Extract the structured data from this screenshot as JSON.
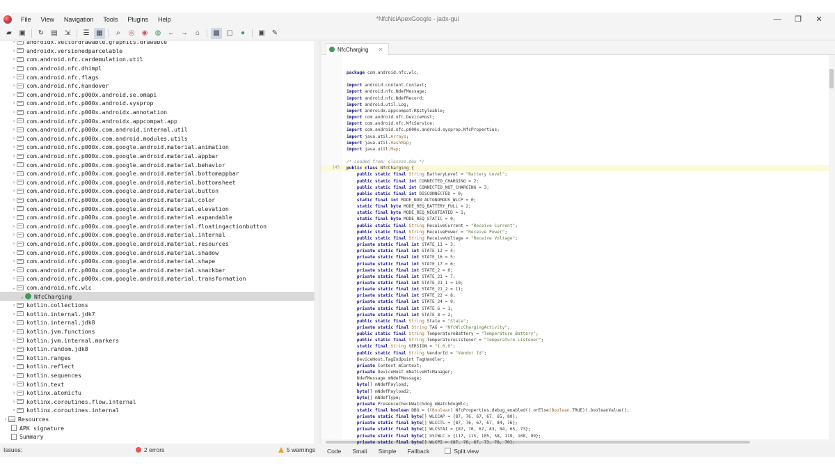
{
  "window": {
    "title": "*NfcNciApexGoogle - jadx-gui"
  },
  "menu": [
    "File",
    "View",
    "Navigation",
    "Tools",
    "Plugins",
    "Help"
  ],
  "window_controls": [
    "—",
    "❐",
    "✕"
  ],
  "toolbar_icons": [
    "open-file-icon",
    "add-file-icon",
    "reload-icon",
    "save-icon",
    "export-icon",
    "flatten-icon",
    "sync-tree-icon",
    "search-icon",
    "find-class-icon",
    "find-usage-icon",
    "find-text-icon",
    "back-icon",
    "forward-icon",
    "home-icon",
    "quark-icon",
    "log-icon",
    "decompile-icon",
    "preferences-icon",
    "settings-icon"
  ],
  "tree": {
    "truncated_top": "androidx.vectordrawable.graphics.drawable",
    "items": [
      "androidx.versionedparcelable",
      "com.android.nfc.cardemulation.util",
      "com.android.nfc.dhimpl",
      "com.android.nfc.flags",
      "com.android.nfc.handover",
      "com.android.nfc.p000x.android.se.omapi",
      "com.android.nfc.p000x.android.sysprop",
      "com.android.nfc.p000x.androidx.annotation",
      "com.android.nfc.p000x.androidx.appcompat.app",
      "com.android.nfc.p000x.com.android.internal.util",
      "com.android.nfc.p000x.com.android.modules.utils",
      "com.android.nfc.p000x.com.google.android.material.animation",
      "com.android.nfc.p000x.com.google.android.material.appbar",
      "com.android.nfc.p000x.com.google.android.material.behavior",
      "com.android.nfc.p000x.com.google.android.material.bottomappbar",
      "com.android.nfc.p000x.com.google.android.material.bottomsheet",
      "com.android.nfc.p000x.com.google.android.material.button",
      "com.android.nfc.p000x.com.google.android.material.color",
      "com.android.nfc.p000x.com.google.android.material.elevation",
      "com.android.nfc.p000x.com.google.android.material.expandable",
      "com.android.nfc.p000x.com.google.android.material.floatingactionbutton",
      "com.android.nfc.p000x.com.google.android.material.internal",
      "com.android.nfc.p000x.com.google.android.material.resources",
      "com.android.nfc.p000x.com.google.android.material.shadow",
      "com.android.nfc.p000x.com.google.android.material.shape",
      "com.android.nfc.p000x.com.google.android.material.snackbar",
      "com.android.nfc.p000x.com.google.android.material.transformation",
      "com.android.nfc.wlc",
      "NfcCharging",
      "kotlin.collections",
      "kotlin.internal.jdk7",
      "kotlin.internal.jdk8",
      "kotlin.jvm.functions",
      "kotlin.jvm.internal.markers",
      "kotlin.random.jdk8",
      "kotlin.ranges",
      "kotlin.reflect",
      "kotlin.sequences",
      "kotlin.text",
      "kotlinx.atomicfu",
      "kotlinx.coroutines.flow.internal",
      "kotlinx.coroutines.internal",
      "Resources",
      "APK signature",
      "Summary"
    ],
    "expanded_chevron": "⌄",
    "collapsed_chevron": "›"
  },
  "editor": {
    "tab_label": "NfcCharging",
    "tab_close": "✕",
    "highlight_line_number": "145",
    "lines": [
      "package com.android.nfc.wlc;",
      "",
      "import android.content.Context;",
      "import android.nfc.NdefMessage;",
      "import android.nfc.NdefRecord;",
      "import android.util.Log;",
      "import androidx.appcompat.R$styleable;",
      "import com.android.nfc.DeviceHost;",
      "import com.android.nfc.NfcService;",
      "import com.android.nfc.p000x.android.sysprop.NfcProperties;",
      "import java.util.Arrays;",
      "import java.util.HashMap;",
      "import java.util.Map;",
      "",
      "/* Loaded from: classes.dex */",
      "public class NfcCharging {",
      "    public static final String BatteryLevel = \"Battery Level\";",
      "    public static final int CONNECTED_CHARGING = 2;",
      "    public static final int CONNECTED_NOT_CHARGING = 3;",
      "    public static final int DISCONNECTED = 0;",
      "    static final int MODE_NON_AUTONOMOUS_WLCP = 0;",
      "    static final byte MODE_REQ_BATTERY_FULL = 2;",
      "    static final byte MODE_REQ_NEGOTIATED = 1;",
      "    static final byte MODE_REQ_STATIC = 0;",
      "    public static final String ReceiveCurrent = \"Receive Current\";",
      "    public static final String ReceivePower = \"Receive Power\";",
      "    public static final String ReceiveVoltage = \"Receive Voltage\";",
      "    private static final int STATE_11 = 3;",
      "    private static final int STATE_12 = 4;",
      "    private static final int STATE_16 = 5;",
      "    private static final int STATE_17 = 6;",
      "    private static final int STATE_2 = 0;",
      "    private static final int STATE_21 = 7;",
      "    private static final int STATE_21_1 = 10;",
      "    private static final int STATE_21_2 = 11;",
      "    private static final int STATE_22 = 8;",
      "    private static final int STATE_24 = 9;",
      "    private static final int STATE_6 = 1;",
      "    private static final int STATE_8 = 2;",
      "    public static final String State = \"State\";",
      "    private static final String TAG = \"NfcWlcChargingActivity\";",
      "    public static final String TemperatureBattery = \"Temperature Battery\";",
      "    public static final String TemperatureListener = \"Temperature Listener\";",
      "    static final String VERSION = \"1.0.0\";",
      "    public static final String VendorId = \"Vendor Id\";",
      "    DeviceHost.TagEndpoint TagHandler;",
      "    private Context mContext;",
      "    private DeviceHost mNativeNfcManager;",
      "    NdefMessage mNdefMessage;",
      "    byte[] mNdefPayload;",
      "    byte[] mNdefPayload2;",
      "    byte[] mNdefType;",
      "    private PresenceCheckWatchdog mWatchdogWlc;",
      "    static final boolean DBG = ((Boolean) NfcProperties.debug_enabled().orElse(Boolean.TRUE)).booleanValue();",
      "    private static final byte[] WLCCAP = {87, 76, 67, 67, 65, 80};",
      "    private static final byte[] WLCCTL = {87, 76, 67, 67, 84, 76};",
      "    private static final byte[] WLCSTAI = {87, 76, 67, 83, 84, 65, 73};",
      "    private static final byte[] USIWLC = {117, 115, 105, 58, 119, 108, 99};",
      "    private static final byte[] WLCPI = {87, 76, 67, 73, 78, 70};"
    ]
  },
  "view_modes": [
    "Code",
    "Smali",
    "Simple",
    "Fallback"
  ],
  "split_view_label": "Split view",
  "status": {
    "issues_label": "Issues:",
    "errors": "2 errors",
    "warnings": "5 warnings"
  }
}
